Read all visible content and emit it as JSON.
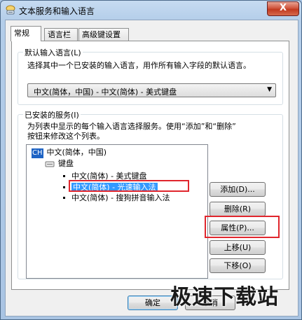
{
  "window": {
    "title": "文本服务和输入语言",
    "close_label": "X"
  },
  "tabs": [
    {
      "label": "常规"
    },
    {
      "label": "语言栏"
    },
    {
      "label": "高级键设置"
    }
  ],
  "default_language": {
    "group_label": "默认输入语言(L)",
    "description": "选择其中一个已安装的输入语言，用作所有输入字段的默认语言。",
    "selected": "中文(简体，中国) - 中文(简体) - 美式键盘"
  },
  "installed_services": {
    "group_label": "已安装的服务(I)",
    "description_line1": "为列表中显示的每个输入语言选择服务。使用“添加”和“删除”",
    "description_line2": "按钮来修改这个列表。",
    "tree": {
      "language_badge": "CH",
      "language": "中文(简体，中国)",
      "category": "键盘",
      "items": [
        {
          "label": "中文(简体) - 美式键盘"
        },
        {
          "label": "中文(简体) - 光速输入法"
        },
        {
          "label": "中文(简体) - 搜狗拼音输入法"
        }
      ]
    },
    "buttons": {
      "add": "添加(D)...",
      "remove": "删除(R)",
      "properties": "属性(P)...",
      "move_up": "上移(U)",
      "move_down": "下移(O)"
    }
  },
  "footer": {
    "ok": "确定",
    "cancel": "取消"
  },
  "watermark": "极速下载站",
  "colors": {
    "highlight": "#e0262d",
    "selection": "#3399ff"
  }
}
